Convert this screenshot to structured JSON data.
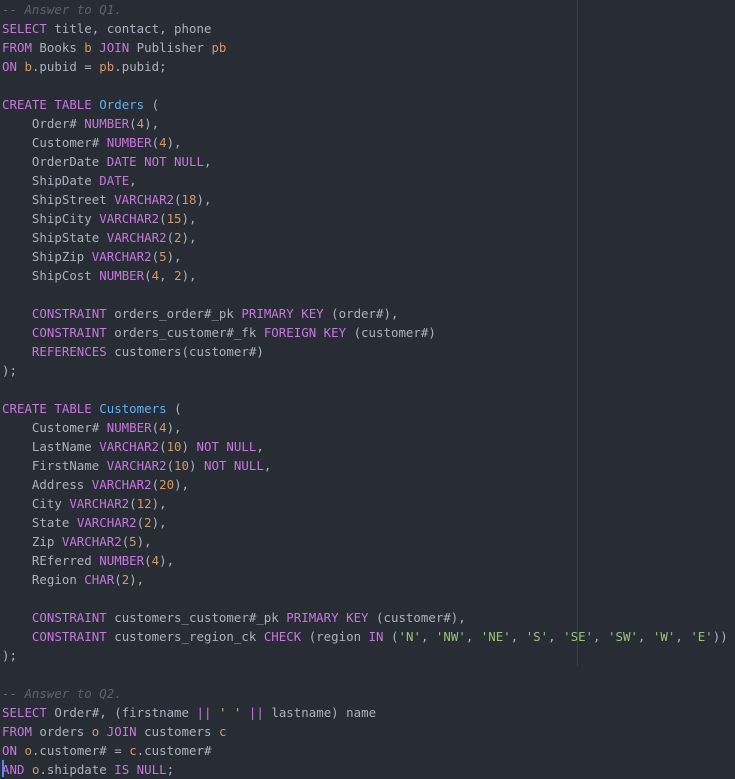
{
  "editor": {
    "background_color": "#282c34",
    "ruler_color": "#3c4049",
    "cursor_color": "#528bff",
    "language": "SQL",
    "ruler_column": 72
  },
  "palette": {
    "keyword": "#c678dd",
    "table_name": "#61afef",
    "identifier": "#abb2bf",
    "number": "#d19a66",
    "string": "#98c379",
    "comment": "#5c6370",
    "alias": "#d19a66",
    "operator": "#abb2bf"
  },
  "code": {
    "lines": [
      "-- Answer to Q1.",
      "SELECT title, contact, phone",
      "FROM Books b JOIN Publisher pb",
      "ON b.pubid = pb.pubid;",
      "",
      "CREATE TABLE Orders (",
      "    Order# NUMBER(4),",
      "    Customer# NUMBER(4),",
      "    OrderDate DATE NOT NULL,",
      "    ShipDate DATE,",
      "    ShipStreet VARCHAR2(18),",
      "    ShipCity VARCHAR2(15),",
      "    ShipState VARCHAR2(2),",
      "    ShipZip VARCHAR2(5),",
      "    ShipCost NUMBER(4, 2),",
      "",
      "    CONSTRAINT orders_order#_pk PRIMARY KEY (order#),",
      "    CONSTRAINT orders_customer#_fk FOREIGN KEY (customer#)",
      "    REFERENCES customers(customer#)",
      ");",
      "",
      "CREATE TABLE Customers (",
      "    Customer# NUMBER(4),",
      "    LastName VARCHAR2(10) NOT NULL,",
      "    FirstName VARCHAR2(10) NOT NULL,",
      "    Address VARCHAR2(20),",
      "    City VARCHAR2(12),",
      "    State VARCHAR2(2),",
      "    Zip VARCHAR2(5),",
      "    REferred NUMBER(4),",
      "    Region CHAR(2),",
      "",
      "    CONSTRAINT customers_customer#_pk PRIMARY KEY (customer#),",
      "    CONSTRAINT customers_region_ck CHECK (region IN ('N', 'NW', 'NE', 'S', 'SE', 'SW', 'W', 'E'))",
      ");",
      "",
      "-- Answer to Q2.",
      "SELECT Order#, (firstname || ' ' || lastname) name",
      "FROM orders o JOIN customers c",
      "ON o.customer# = c.customer#",
      "AND o.shipdate IS NULL;"
    ],
    "tokens": [
      [
        [
          "-- Answer to Q1.",
          "cmt"
        ]
      ],
      [
        [
          "SELECT",
          "kw"
        ],
        [
          " title, contact, phone",
          "id"
        ]
      ],
      [
        [
          "FROM",
          "kw"
        ],
        [
          " Books ",
          "id"
        ],
        [
          "b",
          "alias"
        ],
        [
          " ",
          "id"
        ],
        [
          "JOIN",
          "kw"
        ],
        [
          " Publisher ",
          "id"
        ],
        [
          "pb",
          "alias"
        ]
      ],
      [
        [
          "ON",
          "kw"
        ],
        [
          " ",
          "id"
        ],
        [
          "b",
          "alias"
        ],
        [
          ".pubid ",
          "id"
        ],
        [
          "=",
          "op"
        ],
        [
          " ",
          "id"
        ],
        [
          "pb",
          "alias"
        ],
        [
          ".pubid",
          "id"
        ],
        [
          ";",
          "pun"
        ]
      ],
      [],
      [
        [
          "CREATE TABLE",
          "kw"
        ],
        [
          " ",
          "id"
        ],
        [
          "Orders",
          "tbl"
        ],
        [
          " ",
          "id"
        ],
        [
          "(",
          "pun"
        ]
      ],
      [
        [
          "    Order# ",
          "id"
        ],
        [
          "NUMBER",
          "kw"
        ],
        [
          "(",
          "pun"
        ],
        [
          "4",
          "num"
        ],
        [
          "),",
          "pun"
        ]
      ],
      [
        [
          "    Customer# ",
          "id"
        ],
        [
          "NUMBER",
          "kw"
        ],
        [
          "(",
          "pun"
        ],
        [
          "4",
          "num"
        ],
        [
          "),",
          "pun"
        ]
      ],
      [
        [
          "    OrderDate ",
          "id"
        ],
        [
          "DATE NOT NULL",
          "kw"
        ],
        [
          ",",
          "pun"
        ]
      ],
      [
        [
          "    ShipDate ",
          "id"
        ],
        [
          "DATE",
          "kw"
        ],
        [
          ",",
          "pun"
        ]
      ],
      [
        [
          "    ShipStreet ",
          "id"
        ],
        [
          "VARCHAR2",
          "kw"
        ],
        [
          "(",
          "pun"
        ],
        [
          "18",
          "num"
        ],
        [
          "),",
          "pun"
        ]
      ],
      [
        [
          "    ShipCity ",
          "id"
        ],
        [
          "VARCHAR2",
          "kw"
        ],
        [
          "(",
          "pun"
        ],
        [
          "15",
          "num"
        ],
        [
          "),",
          "pun"
        ]
      ],
      [
        [
          "    ShipState ",
          "id"
        ],
        [
          "VARCHAR2",
          "kw"
        ],
        [
          "(",
          "pun"
        ],
        [
          "2",
          "num"
        ],
        [
          "),",
          "pun"
        ]
      ],
      [
        [
          "    ShipZip ",
          "id"
        ],
        [
          "VARCHAR2",
          "kw"
        ],
        [
          "(",
          "pun"
        ],
        [
          "5",
          "num"
        ],
        [
          "),",
          "pun"
        ]
      ],
      [
        [
          "    ShipCost ",
          "id"
        ],
        [
          "NUMBER",
          "kw"
        ],
        [
          "(",
          "pun"
        ],
        [
          "4",
          "num"
        ],
        [
          ", ",
          "pun"
        ],
        [
          "2",
          "num"
        ],
        [
          "),",
          "pun"
        ]
      ],
      [],
      [
        [
          "    ",
          "id"
        ],
        [
          "CONSTRAINT",
          "kw"
        ],
        [
          " orders_order#_pk ",
          "id"
        ],
        [
          "PRIMARY KEY",
          "kw"
        ],
        [
          " (order#),",
          "id"
        ]
      ],
      [
        [
          "    ",
          "id"
        ],
        [
          "CONSTRAINT",
          "kw"
        ],
        [
          " orders_customer#_fk ",
          "id"
        ],
        [
          "FOREIGN KEY",
          "kw"
        ],
        [
          " (customer#)",
          "id"
        ]
      ],
      [
        [
          "    ",
          "id"
        ],
        [
          "REFERENCES",
          "kw"
        ],
        [
          " customers(customer#)",
          "id"
        ]
      ],
      [
        [
          ");",
          "pun"
        ]
      ],
      [],
      [
        [
          "CREATE TABLE",
          "kw"
        ],
        [
          " ",
          "id"
        ],
        [
          "Customers",
          "tbl"
        ],
        [
          " ",
          "id"
        ],
        [
          "(",
          "pun"
        ]
      ],
      [
        [
          "    Customer# ",
          "id"
        ],
        [
          "NUMBER",
          "kw"
        ],
        [
          "(",
          "pun"
        ],
        [
          "4",
          "num"
        ],
        [
          "),",
          "pun"
        ]
      ],
      [
        [
          "    LastName ",
          "id"
        ],
        [
          "VARCHAR2",
          "kw"
        ],
        [
          "(",
          "pun"
        ],
        [
          "10",
          "num"
        ],
        [
          ") ",
          "pun"
        ],
        [
          "NOT NULL",
          "kw"
        ],
        [
          ",",
          "pun"
        ]
      ],
      [
        [
          "    FirstName ",
          "id"
        ],
        [
          "VARCHAR2",
          "kw"
        ],
        [
          "(",
          "pun"
        ],
        [
          "10",
          "num"
        ],
        [
          ") ",
          "pun"
        ],
        [
          "NOT NULL",
          "kw"
        ],
        [
          ",",
          "pun"
        ]
      ],
      [
        [
          "    Address ",
          "id"
        ],
        [
          "VARCHAR2",
          "kw"
        ],
        [
          "(",
          "pun"
        ],
        [
          "20",
          "num"
        ],
        [
          "),",
          "pun"
        ]
      ],
      [
        [
          "    City ",
          "id"
        ],
        [
          "VARCHAR2",
          "kw"
        ],
        [
          "(",
          "pun"
        ],
        [
          "12",
          "num"
        ],
        [
          "),",
          "pun"
        ]
      ],
      [
        [
          "    State ",
          "id"
        ],
        [
          "VARCHAR2",
          "kw"
        ],
        [
          "(",
          "pun"
        ],
        [
          "2",
          "num"
        ],
        [
          "),",
          "pun"
        ]
      ],
      [
        [
          "    Zip ",
          "id"
        ],
        [
          "VARCHAR2",
          "kw"
        ],
        [
          "(",
          "pun"
        ],
        [
          "5",
          "num"
        ],
        [
          "),",
          "pun"
        ]
      ],
      [
        [
          "    REferred ",
          "id"
        ],
        [
          "NUMBER",
          "kw"
        ],
        [
          "(",
          "pun"
        ],
        [
          "4",
          "num"
        ],
        [
          "),",
          "pun"
        ]
      ],
      [
        [
          "    Region ",
          "id"
        ],
        [
          "CHAR",
          "kw"
        ],
        [
          "(",
          "pun"
        ],
        [
          "2",
          "num"
        ],
        [
          "),",
          "pun"
        ]
      ],
      [],
      [
        [
          "    ",
          "id"
        ],
        [
          "CONSTRAINT",
          "kw"
        ],
        [
          " customers_customer#_pk ",
          "id"
        ],
        [
          "PRIMARY KEY",
          "kw"
        ],
        [
          " (customer#),",
          "id"
        ]
      ],
      [
        [
          "    ",
          "id"
        ],
        [
          "CONSTRAINT",
          "kw"
        ],
        [
          " customers_region_ck ",
          "id"
        ],
        [
          "CHECK",
          "kw"
        ],
        [
          " (region ",
          "id"
        ],
        [
          "IN",
          "kw"
        ],
        [
          " (",
          "pun"
        ],
        [
          "'N'",
          "str"
        ],
        [
          ", ",
          "pun"
        ],
        [
          "'NW'",
          "str"
        ],
        [
          ", ",
          "pun"
        ],
        [
          "'NE'",
          "str"
        ],
        [
          ", ",
          "pun"
        ],
        [
          "'S'",
          "str"
        ],
        [
          ", ",
          "pun"
        ],
        [
          "'SE'",
          "str"
        ],
        [
          ", ",
          "pun"
        ],
        [
          "'SW'",
          "str"
        ],
        [
          ", ",
          "pun"
        ],
        [
          "'W'",
          "str"
        ],
        [
          ", ",
          "pun"
        ],
        [
          "'E'",
          "str"
        ],
        [
          "))",
          "pun"
        ]
      ],
      [
        [
          ");",
          "pun"
        ]
      ],
      [],
      [
        [
          "-- Answer to Q2.",
          "cmt"
        ]
      ],
      [
        [
          "SELECT",
          "kw"
        ],
        [
          " Order#, (firstname ",
          "id"
        ],
        [
          "||",
          "opp"
        ],
        [
          " ",
          "id"
        ],
        [
          "' '",
          "str"
        ],
        [
          " ",
          "id"
        ],
        [
          "||",
          "opp"
        ],
        [
          " lastname) name",
          "id"
        ]
      ],
      [
        [
          "FROM",
          "kw"
        ],
        [
          " orders ",
          "id"
        ],
        [
          "o",
          "alias"
        ],
        [
          " ",
          "id"
        ],
        [
          "JOIN",
          "kw"
        ],
        [
          " customers ",
          "id"
        ],
        [
          "c",
          "alias"
        ]
      ],
      [
        [
          "ON",
          "kw"
        ],
        [
          " ",
          "id"
        ],
        [
          "o",
          "alias"
        ],
        [
          ".customer# ",
          "id"
        ],
        [
          "=",
          "op"
        ],
        [
          " ",
          "id"
        ],
        [
          "c",
          "alias"
        ],
        [
          ".customer#",
          "id"
        ]
      ],
      [
        [
          "AND",
          "kw"
        ],
        [
          " ",
          "id"
        ],
        [
          "o",
          "alias"
        ],
        [
          ".shipdate ",
          "id"
        ],
        [
          "IS NULL",
          "kw"
        ],
        [
          ";",
          "pun"
        ]
      ]
    ]
  }
}
